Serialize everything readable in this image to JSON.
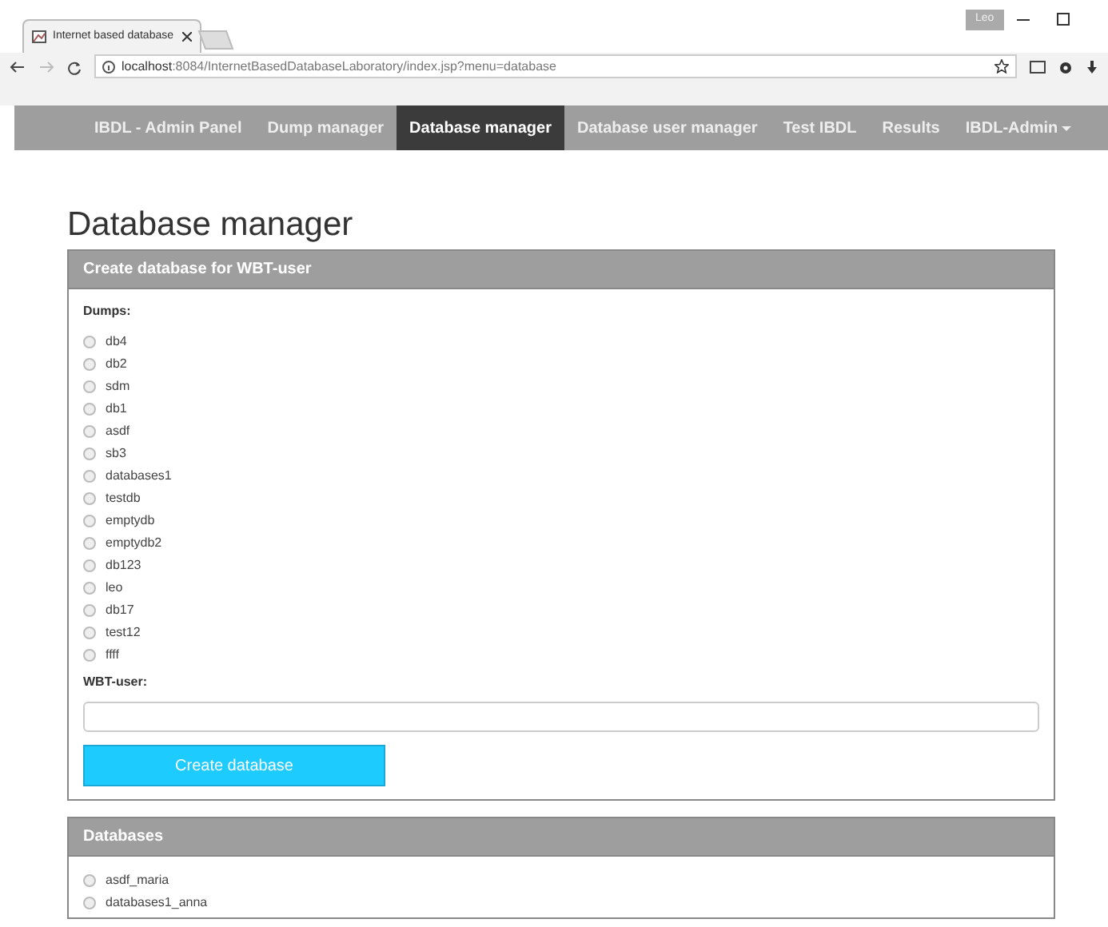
{
  "browser": {
    "tab_title": "Internet based database",
    "user_badge": "Leo",
    "url_host": "localhost",
    "url_rest": ":8084/InternetBasedDatabaseLaboratory/index.jsp?menu=database"
  },
  "navbar": {
    "brand": "IBDL - Admin Panel",
    "items": [
      {
        "label": "Dump manager",
        "selected": false
      },
      {
        "label": "Database manager",
        "selected": true
      },
      {
        "label": "Database user manager",
        "selected": false
      },
      {
        "label": "Test IBDL",
        "selected": false
      },
      {
        "label": "Results",
        "selected": false
      }
    ],
    "user_menu": "IBDL-Admin"
  },
  "page_title": "Database manager",
  "create_panel": {
    "title": "Create database for WBT-user",
    "dumps_label": "Dumps:",
    "dumps": [
      {
        "label": "db4",
        "selected": false
      },
      {
        "label": "db2",
        "selected": false
      },
      {
        "label": "sdm",
        "selected": false
      },
      {
        "label": "db1",
        "selected": false
      },
      {
        "label": "asdf",
        "selected": false
      },
      {
        "label": "sb3",
        "selected": false
      },
      {
        "label": "databases1",
        "selected": false
      },
      {
        "label": "testdb",
        "selected": false
      },
      {
        "label": "emptydb",
        "selected": false
      },
      {
        "label": "emptydb2",
        "selected": false
      },
      {
        "label": "db123",
        "selected": false
      },
      {
        "label": "leo",
        "selected": false
      },
      {
        "label": "db17",
        "selected": false
      },
      {
        "label": "test12",
        "selected": false
      },
      {
        "label": "ffff",
        "selected": false
      }
    ],
    "user_label": "WBT-user:",
    "button": "Create database"
  },
  "databases_panel": {
    "title": "Databases",
    "items": [
      {
        "label": "asdf_maria",
        "selected": false
      },
      {
        "label": "databases1_anna",
        "selected": false
      }
    ]
  }
}
